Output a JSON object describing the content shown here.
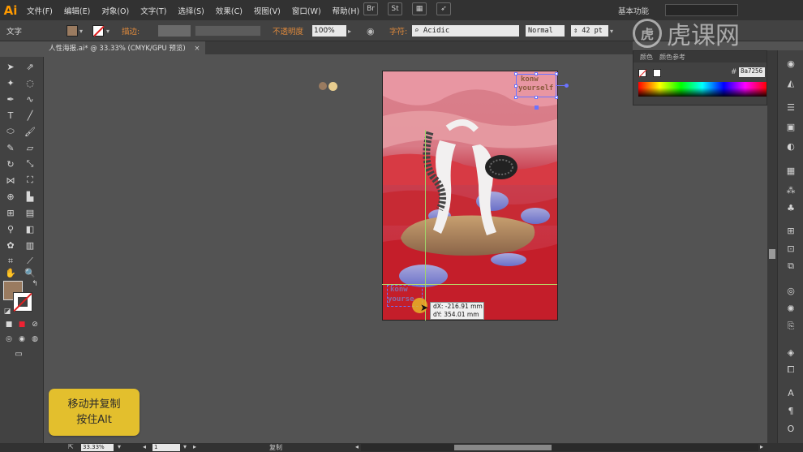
{
  "app": {
    "logo": "Ai"
  },
  "menu": {
    "items": [
      "文件(F)",
      "编辑(E)",
      "对象(O)",
      "文字(T)",
      "选择(S)",
      "效果(C)",
      "视图(V)",
      "窗口(W)",
      "帮助(H)"
    ],
    "toolbar_icons": [
      "bridge-icon",
      "stock-icon",
      "arrange-icon",
      "publish-icon"
    ],
    "workspace": "基本功能"
  },
  "watermark": {
    "text": "虎课网",
    "logo": "虎"
  },
  "control_bar": {
    "type_label": "文字",
    "stroke_label": "描边:",
    "opacity_label": "不透明度",
    "opacity_value": "100%",
    "char_label": "字符:",
    "font_value": "Acidic",
    "style_value": "Normal",
    "size_value": "42 pt",
    "fill_color": "#9a7b60"
  },
  "document": {
    "tab_title": "人性海报.ai* @ 33.33% (CMYK/GPU 预览)",
    "close": "×"
  },
  "color_panel": {
    "tabs": [
      "颜色",
      "颜色参考"
    ],
    "hex_value": "8a7256"
  },
  "canvas": {
    "selected_text": [
      "konw",
      "yourself"
    ],
    "duplicate_text": [
      "konw",
      "yourse"
    ],
    "tooltip": {
      "dx": "dX: -216.91 mm",
      "dy": "dY: 354.01 mm"
    },
    "swatch_colors": [
      "#9a7b60",
      "#e8cd8f"
    ]
  },
  "status_bar": {
    "zoom": "33.33%",
    "page": "1",
    "status": "复制"
  },
  "hint": {
    "line1": "移动并复制",
    "line2": "按住Alt"
  }
}
